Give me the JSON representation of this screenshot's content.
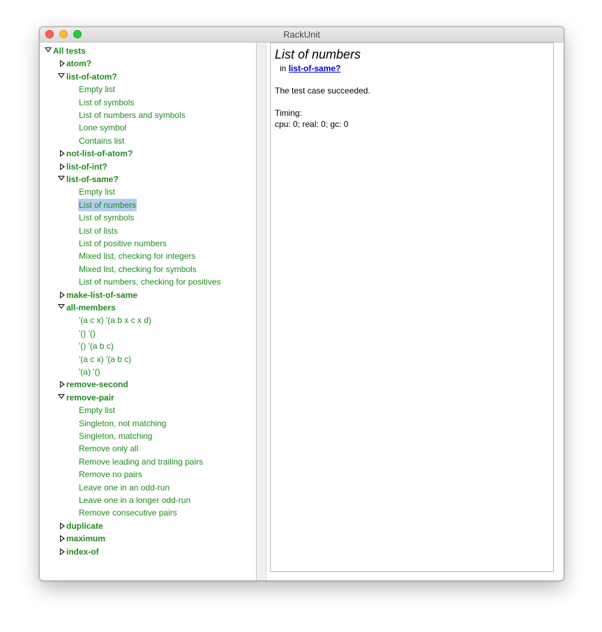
{
  "window": {
    "title": "RackUnit"
  },
  "tree": {
    "root": "All tests",
    "suites": [
      {
        "name": "atom?",
        "expanded": false,
        "cases": []
      },
      {
        "name": "list-of-atom?",
        "expanded": true,
        "cases": [
          "Empty list",
          "List of symbols",
          "List of numbers and symbols",
          "Lone symbol",
          "Contains list"
        ]
      },
      {
        "name": "not-list-of-atom?",
        "expanded": false,
        "cases": []
      },
      {
        "name": "list-of-int?",
        "expanded": false,
        "cases": []
      },
      {
        "name": "list-of-same?",
        "expanded": true,
        "cases": [
          "Empty list",
          "List of numbers",
          "List of symbols",
          "List of lists",
          "List of positive numbers",
          "Mixed list, checking for integers",
          "Mixed list, checking for symbols",
          "List of numbers, checking for positives"
        ]
      },
      {
        "name": "make-list-of-same",
        "expanded": false,
        "cases": []
      },
      {
        "name": "all-members",
        "expanded": true,
        "cases": [
          "'(a c x) '(a b x c x d)",
          "'() '()",
          "'() '(a b c)",
          "'(a c x) '(a b c)",
          "'(a) '()"
        ]
      },
      {
        "name": "remove-second",
        "expanded": false,
        "cases": []
      },
      {
        "name": "remove-pair",
        "expanded": true,
        "cases": [
          "Empty list",
          "Singleton, not matching",
          "Singleton, matching",
          "Remove only all",
          "Remove leading and trailing pairs",
          "Remove no pairs",
          "Leave one in an odd-run",
          "Leave one in a longer odd-run",
          "Remove consecutive pairs"
        ]
      },
      {
        "name": "duplicate",
        "expanded": false,
        "cases": []
      },
      {
        "name": "maximum",
        "expanded": false,
        "cases": []
      },
      {
        "name": "index-of",
        "expanded": false,
        "cases": []
      }
    ],
    "selected": {
      "suite": "list-of-same?",
      "case": "List of numbers"
    }
  },
  "detail": {
    "title": "List of numbers",
    "in_prefix": "in",
    "in_link": "list-of-same?",
    "result": "The test case succeeded.",
    "timing_label": "Timing:",
    "timing_values": "cpu: 0; real: 0; gc: 0"
  },
  "colors": {
    "pass_green": "#1f8a1f",
    "selection": "#b5cdec",
    "link": "#0000cc"
  }
}
